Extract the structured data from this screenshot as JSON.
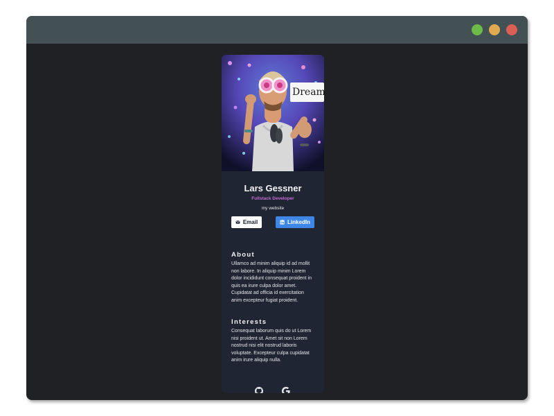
{
  "window": {
    "controls": [
      "green",
      "yellow",
      "red"
    ],
    "colors": {
      "green": "#6cba4a",
      "yellow": "#e0ab4f",
      "red": "#dc5f55",
      "titlebar": "#445154",
      "background": "#1f2124"
    }
  },
  "profile": {
    "name": "Lars Gessner",
    "role": "Fullstack Developer",
    "website_label": "my website",
    "photo_sign_text": "Dream"
  },
  "buttons": {
    "email": "Email",
    "linkedin": "LinkedIn"
  },
  "sections": {
    "about": {
      "title": "About",
      "text": "Ullamco ad minim aliquip id ad mollit non labore. In aliquip minim Lorem dolor incididunt consequat proident in quis ea irure culpa dolor amet. Cupidatat ad officia id exercitation anim excepteur fugiat proident."
    },
    "interests": {
      "title": "Interests",
      "text": "Consequat laborum quis do ut Lorem nisi proident ut. Amet sit non Lorem nostrud nisi elit nostrud laboris voluptate. Excepteur culpa cupidatat anim irure aliquip nulla."
    }
  },
  "footer": {
    "icons": [
      "github-icon",
      "google-icon"
    ]
  },
  "colors": {
    "card": "#1f2533",
    "accent": "#c56cd6",
    "linkedin_button": "#3f87e6"
  }
}
